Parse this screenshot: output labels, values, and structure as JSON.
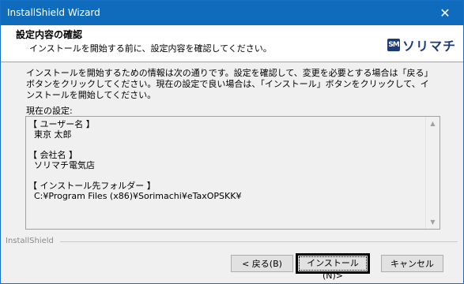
{
  "window": {
    "title": "InstallShield Wizard",
    "close_glyph": "✕"
  },
  "header": {
    "title": "設定内容の確認",
    "subtitle": "インストールを開始する前に、設定内容を確認してください。",
    "logo_mark": "SM",
    "logo_name": "ソリマチ"
  },
  "body": {
    "description": "インストールを開始するための情報は次の通りです。設定を確認して、変更を必要とする場合は「戻る」ボタンをクリックしてください。現在の設定で良い場合は、「インストール」ボタンをクリックして、インストールを開始してください。",
    "current_label": "現在の設定:",
    "settings_text": "【 ユーザー名 】\n  東京 太郎\n\n【 会社名 】\n  ソリマチ電気店\n\n【 インストール先フォルダー 】\n  C:¥Program Files (x86)¥Sorimachi¥eTaxOPSKK¥"
  },
  "footer": {
    "brand": "InstallShield",
    "back_label": "< 戻る(B)",
    "install_label": "インストール(N)>",
    "cancel_label": "キャンセル"
  },
  "icons": {
    "scroll_up": "▲",
    "scroll_down": "▼"
  }
}
